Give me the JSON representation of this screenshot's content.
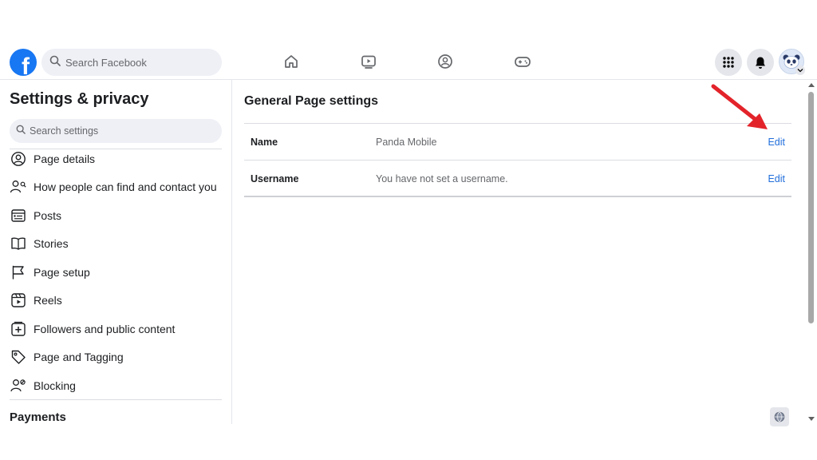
{
  "topbar": {
    "logo_letter": "f",
    "logo_icon": "facebook-logo-icon",
    "search_placeholder": "Search Facebook",
    "nav_icons": [
      "home-icon",
      "watch-icon",
      "groups-icon",
      "gaming-icon"
    ],
    "right_icons": [
      "menu-grid-icon",
      "notifications-bell-icon",
      "profile-avatar"
    ]
  },
  "sidebar": {
    "title": "Settings & privacy",
    "search_placeholder": "Search settings",
    "items": [
      {
        "label": "Page details",
        "icon": "user-circle-icon"
      },
      {
        "label": "How people can find and contact you",
        "icon": "user-search-icon"
      },
      {
        "label": "Posts",
        "icon": "posts-icon"
      },
      {
        "label": "Stories",
        "icon": "book-icon"
      },
      {
        "label": "Page setup",
        "icon": "flag-icon"
      },
      {
        "label": "Reels",
        "icon": "reels-icon"
      },
      {
        "label": "Followers and public content",
        "icon": "add-box-icon"
      },
      {
        "label": "Page and Tagging",
        "icon": "tag-icon"
      },
      {
        "label": "Blocking",
        "icon": "user-block-icon"
      }
    ],
    "section_payments": "Payments"
  },
  "main": {
    "title": "General Page settings",
    "rows": [
      {
        "label": "Name",
        "value": "Panda Mobile",
        "action": "Edit"
      },
      {
        "label": "Username",
        "value": "You have not set a username.",
        "action": "Edit"
      }
    ]
  },
  "colors": {
    "brand_blue": "#1877f2",
    "link_blue": "#216fdb",
    "annotation_red": "#e3232a"
  }
}
